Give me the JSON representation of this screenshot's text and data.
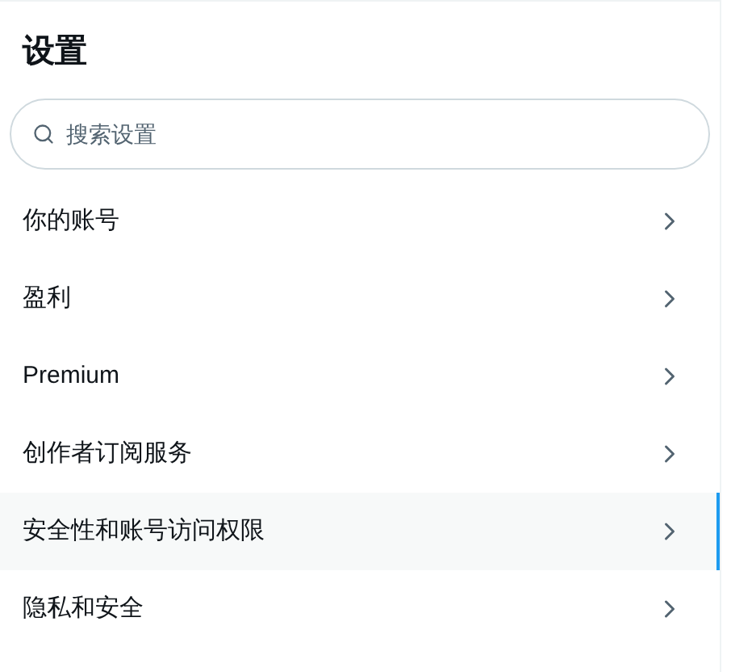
{
  "title": "设置",
  "search": {
    "placeholder": "搜索设置"
  },
  "items": [
    {
      "label": "你的账号",
      "selected": false
    },
    {
      "label": "盈利",
      "selected": false
    },
    {
      "label": "Premium",
      "selected": false
    },
    {
      "label": "创作者订阅服务",
      "selected": false
    },
    {
      "label": "安全性和账号访问权限",
      "selected": true
    },
    {
      "label": "隐私和安全",
      "selected": false
    }
  ]
}
